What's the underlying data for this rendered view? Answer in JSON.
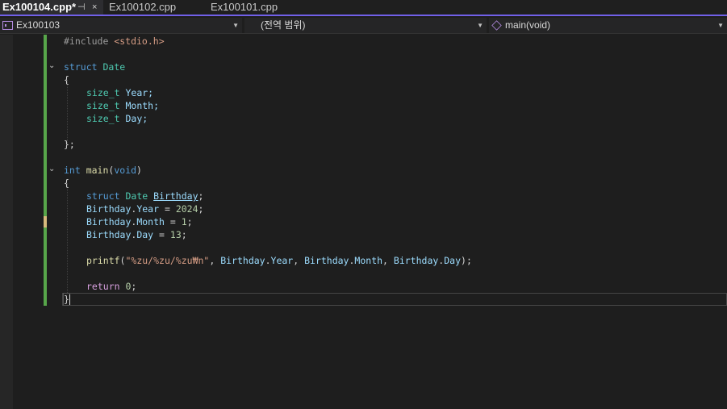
{
  "tabs": [
    {
      "label": "Ex100104.cpp*",
      "active": true
    },
    {
      "label": "Ex100102.cpp",
      "active": false
    },
    {
      "label": "Ex100101.cpp",
      "active": false
    }
  ],
  "tab_pin_glyph": "⊣",
  "tab_close_glyph": "×",
  "navigation": {
    "project": "Ex100103",
    "scope": "(전역 범위)",
    "member": "main(void)",
    "dropdown_glyph": "▼"
  },
  "fold_glyph": "⌄",
  "code": {
    "l1": {
      "pre": "#include ",
      "inc": "<stdio.h>"
    },
    "l3": {
      "kw": "struct",
      "type": " Date"
    },
    "l4": "{",
    "l5": {
      "type": "size_t",
      "field": " Year;"
    },
    "l6": {
      "type": "size_t",
      "field": " Month;"
    },
    "l7": {
      "type": "size_t",
      "field": " Day;"
    },
    "l9": "};",
    "l11": {
      "kw": "int",
      "fn": " main",
      "open": "(",
      "kw2": "void",
      "close": ")"
    },
    "l12": "{",
    "l13": {
      "kw": "struct",
      "type": " Date",
      "sp": " ",
      "var": "Birthday",
      "semi": ";"
    },
    "l14": {
      "var": "Birthday",
      "dot": ".",
      "field": "Year",
      "rest": " = ",
      "num": "2024",
      "semi": ";"
    },
    "l15": {
      "var": "Birthday",
      "dot": ".",
      "field": "Month",
      "rest": " = ",
      "num": "1",
      "semi": ";"
    },
    "l16": {
      "var": "Birthday",
      "dot": ".",
      "field": "Day",
      "rest": " = ",
      "num": "13",
      "semi": ";"
    },
    "l18": {
      "fn": "printf",
      "open": "(",
      "str": "\"%zu/%zu/%zu₩n\"",
      "a1": ", ",
      "v1": "Birthday",
      "d1": ".",
      "f1": "Year",
      "a2": ", ",
      "v2": "Birthday",
      "d2": ".",
      "f2": "Month",
      "a3": ", ",
      "v3": "Birthday",
      "d3": ".",
      "f3": "Day",
      "close": ");"
    },
    "l20": {
      "kw": "return",
      "num": " 0",
      "semi": ";"
    },
    "l21": "}"
  },
  "colors": {
    "accent": "#7160e8",
    "change_bar": "#57a64a",
    "keyword": "#569cd6",
    "type": "#4ec9b0",
    "string": "#d69d85"
  }
}
